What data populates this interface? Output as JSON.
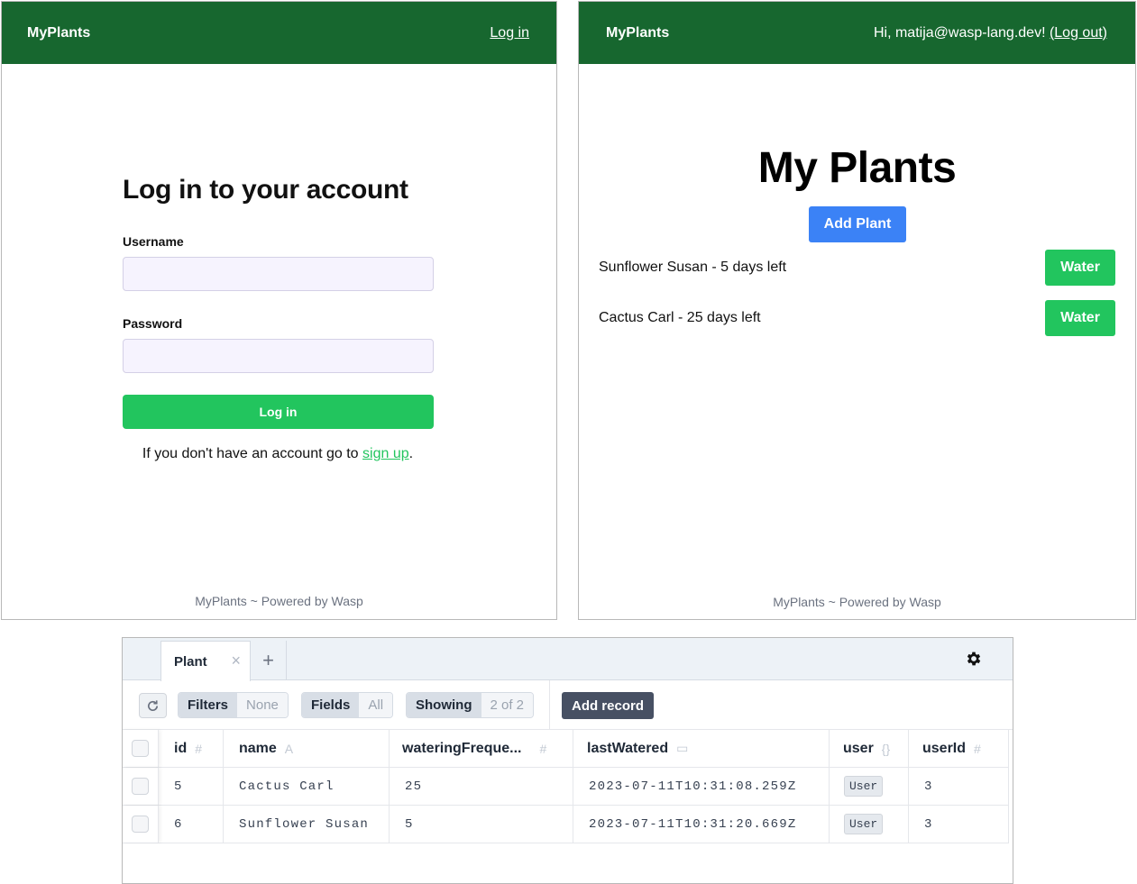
{
  "login_app": {
    "brand": "MyPlants",
    "nav_login": "Log in",
    "title": "Log in to your account",
    "username_label": "Username",
    "username_value": "",
    "password_label": "Password",
    "password_value": "",
    "submit_label": "Log in",
    "signup_prefix": "If you don't have an account go to ",
    "signup_link": "sign up",
    "signup_suffix": ".",
    "footer": "MyPlants ~ Powered by Wasp"
  },
  "plants_app": {
    "brand": "MyPlants",
    "greeting": "Hi, matija@wasp-lang.dev! ",
    "logout": "(Log out)",
    "title": "My Plants",
    "add_plant_label": "Add Plant",
    "plants": [
      {
        "text": "Sunflower Susan - 5 days left",
        "button": "Water"
      },
      {
        "text": "Cactus Carl - 25 days left",
        "button": "Water"
      }
    ],
    "footer": "MyPlants ~ Powered by Wasp"
  },
  "studio": {
    "tab_label": "Plant",
    "tab_close": "×",
    "tab_add": "+",
    "settings_icon": "gear-icon",
    "refresh_icon": "refresh-icon",
    "filters": {
      "label": "Filters",
      "value": "None"
    },
    "fields": {
      "label": "Fields",
      "value": "All"
    },
    "showing": {
      "label": "Showing",
      "value": "2 of 2"
    },
    "add_record_label": "Add record",
    "columns": [
      {
        "name": "id",
        "type": "#"
      },
      {
        "name": "name",
        "type": "A"
      },
      {
        "name": "wateringFreque...",
        "type": "#"
      },
      {
        "name": "lastWatered",
        "type": "▭"
      },
      {
        "name": "user",
        "type": "{}"
      },
      {
        "name": "userId",
        "type": "#"
      }
    ],
    "rows": [
      {
        "id": "5",
        "name": "Cactus Carl",
        "wateringFrequency": "25",
        "lastWatered": "2023-07-11T10:31:08.259Z",
        "user": "User",
        "userId": "3"
      },
      {
        "id": "6",
        "name": "Sunflower Susan",
        "wateringFrequency": "5",
        "lastWatered": "2023-07-11T10:31:20.669Z",
        "user": "User",
        "userId": "3"
      }
    ]
  },
  "colors": {
    "navbar": "#17672f",
    "primary_green": "#22c55e",
    "primary_blue": "#3b82f6",
    "studio_dark_button": "#475063"
  }
}
